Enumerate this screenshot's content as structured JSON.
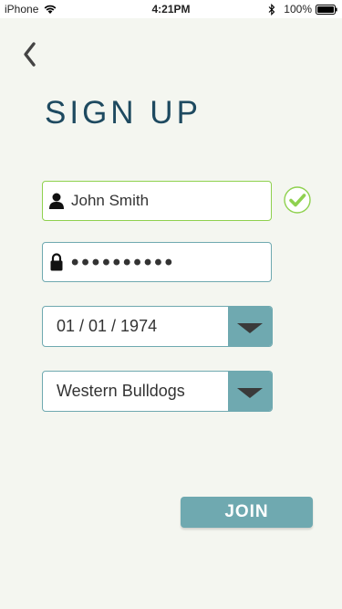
{
  "status_bar": {
    "carrier": "iPhone",
    "time": "4:21PM",
    "battery": "100%"
  },
  "icons": {
    "back": "chevron-left",
    "name_field": "person",
    "password_field": "lock",
    "valid": "check-circle",
    "dropdown": "triangle-down"
  },
  "page": {
    "title": "SIGN UP"
  },
  "form": {
    "name_value": "John Smith",
    "password_value": "••••••••••",
    "dob_value": "01 / 01 / 1974",
    "team_value": "Western Bulldogs",
    "join_label": "JOIN"
  },
  "colors": {
    "accent": "#6fa9b0",
    "title": "#1e4a60",
    "valid": "#8fd14f",
    "background": "#f4f6f0"
  }
}
